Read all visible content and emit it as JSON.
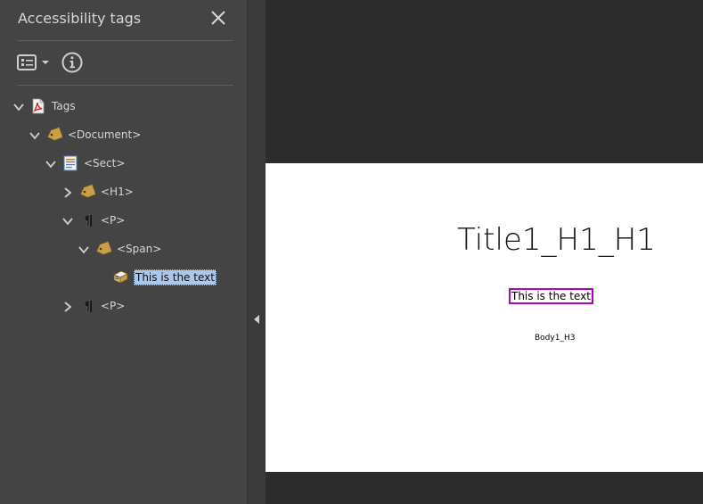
{
  "panel": {
    "title": "Accessibility tags",
    "close_icon": "close-icon",
    "toolbar": {
      "options_icon": "options-menu-icon",
      "info_icon": "info-icon"
    }
  },
  "tree": {
    "tags": {
      "label": "Tags",
      "icon": "pdf-file-icon",
      "expanded": true
    },
    "document": {
      "label": "<Document>",
      "icon": "tag-icon",
      "expanded": true
    },
    "sect": {
      "label": "<Sect>",
      "icon": "section-icon",
      "expanded": true
    },
    "h1": {
      "label": "<H1>",
      "icon": "tag-icon",
      "expanded": false
    },
    "p1": {
      "label": "<P>",
      "icon": "paragraph-icon",
      "expanded": true
    },
    "span": {
      "label": "<Span>",
      "icon": "tag-icon",
      "expanded": true
    },
    "text": {
      "label": "This is the text",
      "icon": "text-content-icon",
      "selected": true
    },
    "p2": {
      "label": "<P>",
      "icon": "paragraph-icon",
      "expanded": false
    }
  },
  "page": {
    "title": "Title1_H1_H1",
    "highlighted_text": "This is the text",
    "body": "Body1_H3"
  },
  "colors": {
    "panel_bg": "#444444",
    "doc_bg": "#2c2c2c",
    "selection": "#a9c9ea",
    "highlight_border": "#b000c8"
  }
}
